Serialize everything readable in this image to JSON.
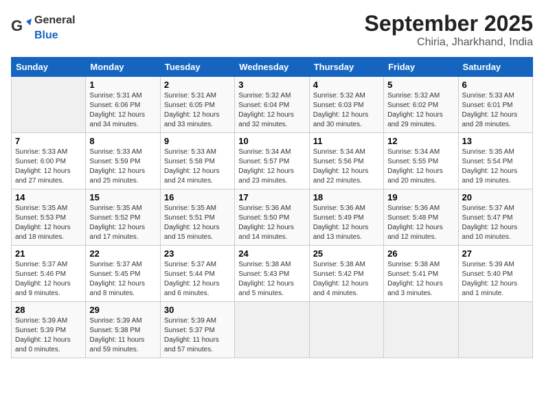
{
  "header": {
    "logo_general": "General",
    "logo_blue": "Blue",
    "title": "September 2025",
    "subtitle": "Chiria, Jharkhand, India"
  },
  "columns": [
    "Sunday",
    "Monday",
    "Tuesday",
    "Wednesday",
    "Thursday",
    "Friday",
    "Saturday"
  ],
  "weeks": [
    [
      {
        "day": "",
        "info": ""
      },
      {
        "day": "1",
        "info": "Sunrise: 5:31 AM\nSunset: 6:06 PM\nDaylight: 12 hours\nand 34 minutes."
      },
      {
        "day": "2",
        "info": "Sunrise: 5:31 AM\nSunset: 6:05 PM\nDaylight: 12 hours\nand 33 minutes."
      },
      {
        "day": "3",
        "info": "Sunrise: 5:32 AM\nSunset: 6:04 PM\nDaylight: 12 hours\nand 32 minutes."
      },
      {
        "day": "4",
        "info": "Sunrise: 5:32 AM\nSunset: 6:03 PM\nDaylight: 12 hours\nand 30 minutes."
      },
      {
        "day": "5",
        "info": "Sunrise: 5:32 AM\nSunset: 6:02 PM\nDaylight: 12 hours\nand 29 minutes."
      },
      {
        "day": "6",
        "info": "Sunrise: 5:33 AM\nSunset: 6:01 PM\nDaylight: 12 hours\nand 28 minutes."
      }
    ],
    [
      {
        "day": "7",
        "info": "Sunrise: 5:33 AM\nSunset: 6:00 PM\nDaylight: 12 hours\nand 27 minutes."
      },
      {
        "day": "8",
        "info": "Sunrise: 5:33 AM\nSunset: 5:59 PM\nDaylight: 12 hours\nand 25 minutes."
      },
      {
        "day": "9",
        "info": "Sunrise: 5:33 AM\nSunset: 5:58 PM\nDaylight: 12 hours\nand 24 minutes."
      },
      {
        "day": "10",
        "info": "Sunrise: 5:34 AM\nSunset: 5:57 PM\nDaylight: 12 hours\nand 23 minutes."
      },
      {
        "day": "11",
        "info": "Sunrise: 5:34 AM\nSunset: 5:56 PM\nDaylight: 12 hours\nand 22 minutes."
      },
      {
        "day": "12",
        "info": "Sunrise: 5:34 AM\nSunset: 5:55 PM\nDaylight: 12 hours\nand 20 minutes."
      },
      {
        "day": "13",
        "info": "Sunrise: 5:35 AM\nSunset: 5:54 PM\nDaylight: 12 hours\nand 19 minutes."
      }
    ],
    [
      {
        "day": "14",
        "info": "Sunrise: 5:35 AM\nSunset: 5:53 PM\nDaylight: 12 hours\nand 18 minutes."
      },
      {
        "day": "15",
        "info": "Sunrise: 5:35 AM\nSunset: 5:52 PM\nDaylight: 12 hours\nand 17 minutes."
      },
      {
        "day": "16",
        "info": "Sunrise: 5:35 AM\nSunset: 5:51 PM\nDaylight: 12 hours\nand 15 minutes."
      },
      {
        "day": "17",
        "info": "Sunrise: 5:36 AM\nSunset: 5:50 PM\nDaylight: 12 hours\nand 14 minutes."
      },
      {
        "day": "18",
        "info": "Sunrise: 5:36 AM\nSunset: 5:49 PM\nDaylight: 12 hours\nand 13 minutes."
      },
      {
        "day": "19",
        "info": "Sunrise: 5:36 AM\nSunset: 5:48 PM\nDaylight: 12 hours\nand 12 minutes."
      },
      {
        "day": "20",
        "info": "Sunrise: 5:37 AM\nSunset: 5:47 PM\nDaylight: 12 hours\nand 10 minutes."
      }
    ],
    [
      {
        "day": "21",
        "info": "Sunrise: 5:37 AM\nSunset: 5:46 PM\nDaylight: 12 hours\nand 9 minutes."
      },
      {
        "day": "22",
        "info": "Sunrise: 5:37 AM\nSunset: 5:45 PM\nDaylight: 12 hours\nand 8 minutes."
      },
      {
        "day": "23",
        "info": "Sunrise: 5:37 AM\nSunset: 5:44 PM\nDaylight: 12 hours\nand 6 minutes."
      },
      {
        "day": "24",
        "info": "Sunrise: 5:38 AM\nSunset: 5:43 PM\nDaylight: 12 hours\nand 5 minutes."
      },
      {
        "day": "25",
        "info": "Sunrise: 5:38 AM\nSunset: 5:42 PM\nDaylight: 12 hours\nand 4 minutes."
      },
      {
        "day": "26",
        "info": "Sunrise: 5:38 AM\nSunset: 5:41 PM\nDaylight: 12 hours\nand 3 minutes."
      },
      {
        "day": "27",
        "info": "Sunrise: 5:39 AM\nSunset: 5:40 PM\nDaylight: 12 hours\nand 1 minute."
      }
    ],
    [
      {
        "day": "28",
        "info": "Sunrise: 5:39 AM\nSunset: 5:39 PM\nDaylight: 12 hours\nand 0 minutes."
      },
      {
        "day": "29",
        "info": "Sunrise: 5:39 AM\nSunset: 5:38 PM\nDaylight: 11 hours\nand 59 minutes."
      },
      {
        "day": "30",
        "info": "Sunrise: 5:39 AM\nSunset: 5:37 PM\nDaylight: 11 hours\nand 57 minutes."
      },
      {
        "day": "",
        "info": ""
      },
      {
        "day": "",
        "info": ""
      },
      {
        "day": "",
        "info": ""
      },
      {
        "day": "",
        "info": ""
      }
    ]
  ]
}
